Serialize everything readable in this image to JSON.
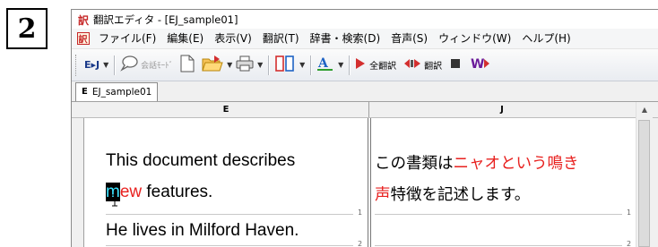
{
  "step": {
    "number": "2"
  },
  "window": {
    "title": "翻訳エディタ - [EJ_sample01]"
  },
  "menu": {
    "items": [
      {
        "label": "ファイル(F)"
      },
      {
        "label": "編集(E)"
      },
      {
        "label": "表示(V)"
      },
      {
        "label": "翻訳(T)"
      },
      {
        "label": "辞書・検索(D)"
      },
      {
        "label": "音声(S)"
      },
      {
        "label": "ウィンドウ(W)"
      },
      {
        "label": "ヘルプ(H)"
      }
    ]
  },
  "toolbar": {
    "direction_label": "E▸J",
    "conversation_mode_label": "会話ﾓｰﾄﾞ",
    "translate_all_label": "全翻訳",
    "translate_label": "翻訳"
  },
  "tab": {
    "letter": "E",
    "label": "EJ_sample01"
  },
  "columns": {
    "english_header": "E",
    "japanese_header": "J"
  },
  "segments": [
    {
      "english_line1": "This document describes",
      "english_sel_char": "m",
      "english_error_rest": "ew",
      "english_line2_rest": " features.",
      "japanese_line1_prefix": "この書類は",
      "japanese_line1_red": "ニャオという鳴き",
      "japanese_line2_red": "声",
      "japanese_line2_rest": "特徴を記述します。",
      "number": "1"
    },
    {
      "english_line1": "He lives in Milford Haven.",
      "number": "2"
    }
  ],
  "colors": {
    "error_red": "#e8211f",
    "selection_cyan": "#3ce3ff"
  }
}
